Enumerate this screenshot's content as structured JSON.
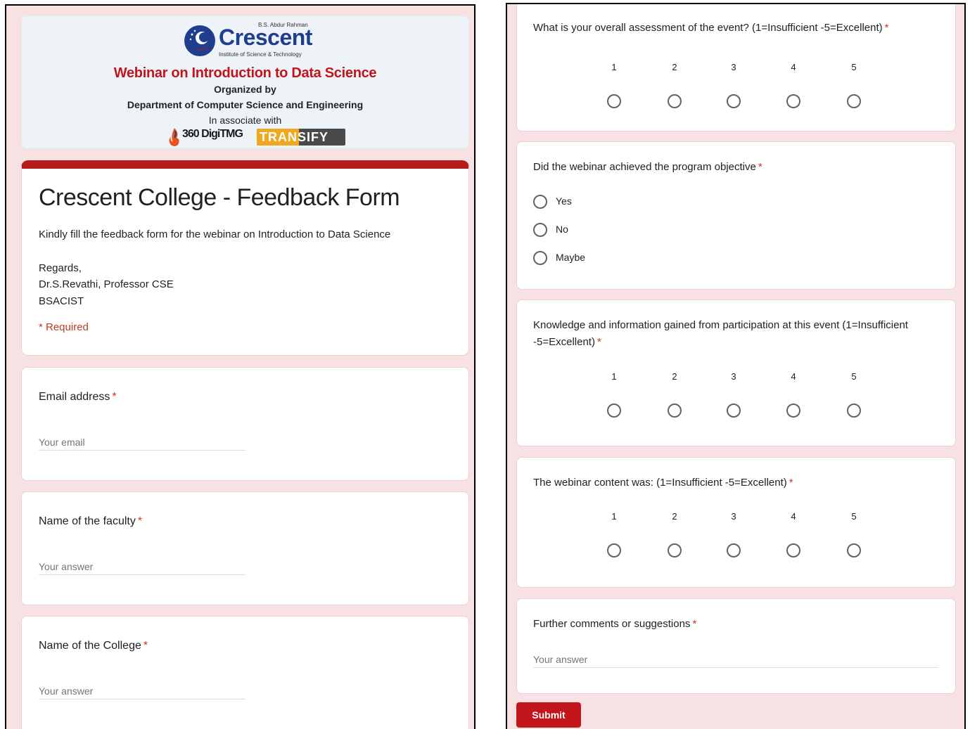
{
  "banner": {
    "institute_top": "B.S. Abdur Rahman",
    "logo_word": "Crescent",
    "institute_sub": "Institute of Science & Technology",
    "title": "Webinar on Introduction to Data Science",
    "organized": "Organized by",
    "department": "Department of Computer Science and Engineering",
    "associate": "In associate with",
    "partner1": "360 DigiTMG",
    "partner2": "TRANSIFY"
  },
  "form": {
    "title": "Crescent College - Feedback Form",
    "description": "Kindly fill the feedback form for the webinar on Introduction to Data Science",
    "regards": "Regards,",
    "signature": "Dr.S.Revathi, Professor CSE",
    "org": "BSACIST",
    "required_note": "* Required"
  },
  "questions": {
    "email": {
      "label": "Email address",
      "placeholder": "Your email"
    },
    "faculty": {
      "label": "Name of the faculty",
      "placeholder": "Your answer"
    },
    "college": {
      "label": "Name of the College",
      "placeholder": "Your answer"
    },
    "overall": {
      "label": "What is your overall assessment of the event? (1=Insufficient -5=Excellent)"
    },
    "objective": {
      "label": "Did the webinar achieved the program objective",
      "options": [
        "Yes",
        "No",
        "Maybe"
      ]
    },
    "knowledge": {
      "label": "Knowledge and information gained from participation at this event (1=Insufficient -5=Excellent)"
    },
    "content": {
      "label": "The webinar content was: (1=Insufficient -5=Excellent)"
    },
    "comments": {
      "label": "Further comments or suggestions",
      "placeholder": "Your answer"
    }
  },
  "scale": [
    "1",
    "2",
    "3",
    "4",
    "5"
  ],
  "required_star": "*",
  "submit_label": "Submit",
  "colors": {
    "accent": "#c3151c",
    "page_background": "#f7e1e2",
    "required": "#d93025"
  }
}
